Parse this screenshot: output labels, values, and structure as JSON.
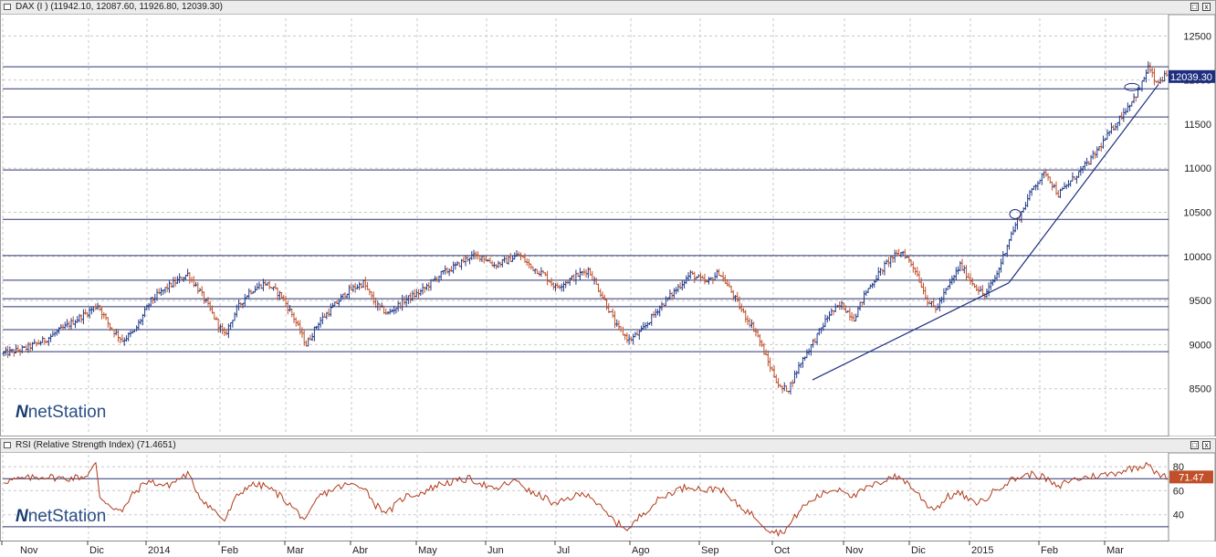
{
  "main_panel": {
    "title": "DAX (I ) (11942.10, 12087.60, 11926.80, 12039.30)",
    "last_value": "12039.30",
    "logo": "netStation",
    "btn_min": "□",
    "btn_close": "x"
  },
  "rsi_panel": {
    "title": "RSI (Relative Strength Index) (71.4651)",
    "last_value": "71.47",
    "logo": "netStation",
    "btn_min": "□",
    "btn_close": "x"
  },
  "x_axis_labels": [
    "Nov",
    "Dic",
    "2014",
    "Feb",
    "Mar",
    "Abr",
    "May",
    "Jun",
    "Jul",
    "Ago",
    "Sep",
    "Oct",
    "Nov",
    "Dic",
    "2015",
    "Feb",
    "Mar"
  ],
  "colors": {
    "up": "#1f3a8a",
    "down": "#c0502a",
    "rsi": "#b03a1a",
    "trend": "#1f2f80",
    "hline": "#2b3570",
    "grid": "#c8c8c8"
  },
  "chart_data": [
    {
      "type": "ohlc",
      "title": "DAX (I ) (11942.10, 12087.60, 11926.80, 12039.30)",
      "y_ticks": [
        8500,
        9000,
        9500,
        10000,
        10500,
        11000,
        11500,
        12000,
        12500
      ],
      "ylim": [
        8000,
        12700
      ],
      "x_labels": [
        "Nov",
        "Dic",
        "2014",
        "Feb",
        "Mar",
        "Abr",
        "May",
        "Jun",
        "Jul",
        "Ago",
        "Sep",
        "Oct",
        "Nov",
        "Dic",
        "2015",
        "Feb",
        "Mar"
      ],
      "horizontal_levels": [
        12150,
        11900,
        11580,
        10980,
        10420,
        10010,
        9730,
        9520,
        9430,
        9170,
        8920
      ],
      "trendlines": [
        {
          "from": [
            "Oct 2014",
            8600
          ],
          "to": [
            "Ene 2015",
            9700
          ]
        },
        {
          "from": [
            "Ene 2015",
            9700
          ],
          "to": [
            "Mar 2015",
            11950
          ]
        }
      ],
      "last": {
        "open": 11942.1,
        "high": 12087.6,
        "low": 11926.8,
        "close": 12039.3
      },
      "anchors": [
        [
          0,
          8900
        ],
        [
          10,
          8950
        ],
        [
          20,
          9050
        ],
        [
          30,
          9200
        ],
        [
          40,
          9350
        ],
        [
          46,
          9450
        ],
        [
          52,
          9200
        ],
        [
          58,
          9050
        ],
        [
          64,
          9150
        ],
        [
          72,
          9500
        ],
        [
          80,
          9650
        ],
        [
          90,
          9800
        ],
        [
          96,
          9600
        ],
        [
          102,
          9350
        ],
        [
          108,
          9100
        ],
        [
          114,
          9400
        ],
        [
          120,
          9600
        ],
        [
          128,
          9700
        ],
        [
          136,
          9550
        ],
        [
          142,
          9300
        ],
        [
          148,
          9000
        ],
        [
          154,
          9250
        ],
        [
          162,
          9450
        ],
        [
          168,
          9600
        ],
        [
          176,
          9700
        ],
        [
          182,
          9450
        ],
        [
          188,
          9350
        ],
        [
          196,
          9500
        ],
        [
          204,
          9600
        ],
        [
          214,
          9800
        ],
        [
          222,
          9900
        ],
        [
          228,
          10000
        ],
        [
          234,
          10000
        ],
        [
          240,
          9900
        ],
        [
          246,
          9950
        ],
        [
          252,
          10020
        ],
        [
          258,
          9880
        ],
        [
          264,
          9800
        ],
        [
          270,
          9650
        ],
        [
          278,
          9750
        ],
        [
          286,
          9850
        ],
        [
          294,
          9500
        ],
        [
          300,
          9200
        ],
        [
          306,
          9050
        ],
        [
          312,
          9150
        ],
        [
          320,
          9400
        ],
        [
          328,
          9600
        ],
        [
          336,
          9800
        ],
        [
          344,
          9700
        ],
        [
          350,
          9820
        ],
        [
          356,
          9600
        ],
        [
          362,
          9350
        ],
        [
          368,
          9150
        ],
        [
          374,
          8800
        ],
        [
          380,
          8500
        ],
        [
          384,
          8500
        ],
        [
          390,
          8800
        ],
        [
          398,
          9100
        ],
        [
          404,
          9350
        ],
        [
          410,
          9450
        ],
        [
          416,
          9300
        ],
        [
          422,
          9600
        ],
        [
          428,
          9800
        ],
        [
          434,
          9980
        ],
        [
          440,
          10050
        ],
        [
          446,
          9850
        ],
        [
          452,
          9500
        ],
        [
          456,
          9400
        ],
        [
          462,
          9650
        ],
        [
          468,
          9900
        ],
        [
          474,
          9700
        ],
        [
          480,
          9550
        ],
        [
          486,
          9800
        ],
        [
          492,
          10200
        ],
        [
          498,
          10500
        ],
        [
          504,
          10800
        ],
        [
          510,
          10950
        ],
        [
          516,
          10700
        ],
        [
          520,
          10800
        ],
        [
          526,
          10950
        ],
        [
          532,
          11100
        ],
        [
          538,
          11300
        ],
        [
          544,
          11500
        ],
        [
          550,
          11700
        ],
        [
          556,
          11900
        ],
        [
          560,
          12150
        ],
        [
          564,
          11950
        ],
        [
          568,
          12039
        ]
      ]
    },
    {
      "type": "line",
      "title": "RSI (Relative Strength Index) (71.4651)",
      "y_ticks": [
        40,
        60,
        80
      ],
      "ylim": [
        20,
        90
      ],
      "levels": [
        70,
        30
      ],
      "last_value": 71.47,
      "anchors": [
        [
          0,
          68
        ],
        [
          10,
          70
        ],
        [
          20,
          72
        ],
        [
          30,
          70
        ],
        [
          40,
          72
        ],
        [
          45,
          82
        ],
        [
          47,
          55
        ],
        [
          52,
          48
        ],
        [
          58,
          42
        ],
        [
          62,
          55
        ],
        [
          70,
          68
        ],
        [
          80,
          64
        ],
        [
          90,
          74
        ],
        [
          96,
          55
        ],
        [
          102,
          45
        ],
        [
          108,
          35
        ],
        [
          114,
          55
        ],
        [
          120,
          65
        ],
        [
          128,
          64
        ],
        [
          136,
          55
        ],
        [
          142,
          45
        ],
        [
          148,
          35
        ],
        [
          154,
          55
        ],
        [
          162,
          62
        ],
        [
          168,
          65
        ],
        [
          176,
          64
        ],
        [
          182,
          48
        ],
        [
          188,
          42
        ],
        [
          196,
          55
        ],
        [
          204,
          58
        ],
        [
          214,
          66
        ],
        [
          222,
          68
        ],
        [
          228,
          70
        ],
        [
          234,
          66
        ],
        [
          240,
          60
        ],
        [
          246,
          66
        ],
        [
          252,
          68
        ],
        [
          258,
          58
        ],
        [
          264,
          55
        ],
        [
          270,
          48
        ],
        [
          278,
          55
        ],
        [
          286,
          58
        ],
        [
          294,
          42
        ],
        [
          300,
          33
        ],
        [
          306,
          28
        ],
        [
          312,
          40
        ],
        [
          320,
          52
        ],
        [
          328,
          60
        ],
        [
          336,
          64
        ],
        [
          344,
          60
        ],
        [
          350,
          63
        ],
        [
          356,
          52
        ],
        [
          362,
          45
        ],
        [
          368,
          38
        ],
        [
          374,
          28
        ],
        [
          380,
          25
        ],
        [
          384,
          30
        ],
        [
          390,
          45
        ],
        [
          398,
          55
        ],
        [
          404,
          60
        ],
        [
          410,
          62
        ],
        [
          416,
          55
        ],
        [
          422,
          62
        ],
        [
          428,
          66
        ],
        [
          434,
          72
        ],
        [
          440,
          70
        ],
        [
          446,
          60
        ],
        [
          452,
          48
        ],
        [
          456,
          45
        ],
        [
          462,
          55
        ],
        [
          468,
          58
        ],
        [
          474,
          50
        ],
        [
          480,
          52
        ],
        [
          486,
          62
        ],
        [
          492,
          68
        ],
        [
          498,
          72
        ],
        [
          504,
          74
        ],
        [
          510,
          70
        ],
        [
          516,
          62
        ],
        [
          520,
          68
        ],
        [
          526,
          70
        ],
        [
          532,
          72
        ],
        [
          538,
          73
        ],
        [
          544,
          75
        ],
        [
          550,
          78
        ],
        [
          556,
          80
        ],
        [
          560,
          84
        ],
        [
          564,
          74
        ],
        [
          568,
          71.47
        ]
      ]
    }
  ]
}
